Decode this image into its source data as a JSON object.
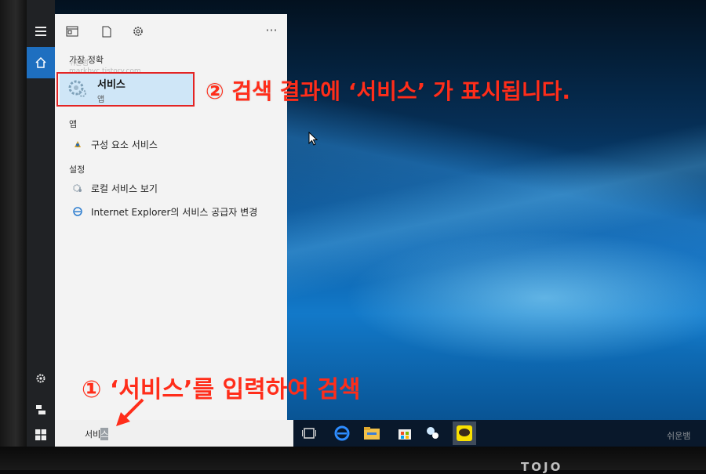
{
  "start_panel": {
    "best_match_label": "가장 정확",
    "best_match_title": "서비스",
    "best_match_sub": "앱",
    "apps_label": "앱",
    "app_result": "구성 요소 서비스",
    "settings_label": "설정",
    "settings_results": [
      "로컬 서비스 보기",
      "Internet Explorer의 서비스 공급자 변경"
    ],
    "more_label": "···",
    "blog_mark": "쉬운뱀\nmarkbyc.tistory.com"
  },
  "search": {
    "typed": "서비",
    "selected": "스"
  },
  "annotations": {
    "step2": "② 검색 결과에 ‘서비스’ 가 표시됩니다.",
    "step1": "① ‘서비스’를 입력하여 검색"
  },
  "watermark": "쉬운뱀",
  "brand": "TOJO",
  "colors": {
    "annotation_red": "#ff2d1a",
    "highlight_border": "#e32424",
    "rail_active": "#1e6fc0",
    "best_match_bg": "#cfe6f7"
  },
  "icons": [
    "hamburger-icon",
    "home-icon",
    "settings-gear-icon",
    "user-icon",
    "windows-icon",
    "apps-grid-icon",
    "document-icon",
    "gear-icon",
    "more-icon",
    "services-gear-icon",
    "component-services-icon",
    "local-services-icon",
    "ie-provider-icon",
    "task-view-icon",
    "edge-icon",
    "file-explorer-icon",
    "store-icon",
    "people-icon",
    "kakaotalk-icon",
    "cursor-icon"
  ]
}
